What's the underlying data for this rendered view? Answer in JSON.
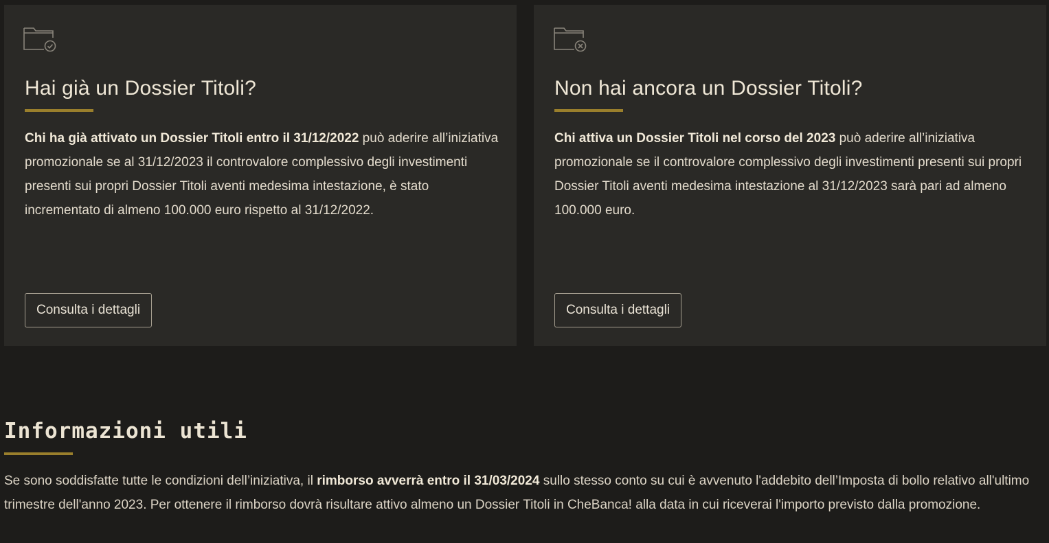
{
  "cards": [
    {
      "icon": "folder-check-icon",
      "title": "Hai già un Dossier Titoli?",
      "body_bold": "Chi ha già attivato un Dossier Titoli entro il 31/12/2022",
      "body_rest": " può aderire all’iniziativa promozionale se al 31/12/2023 il controvalore complessivo degli investimenti presenti sui propri Dossier Titoli aventi medesima intestazione, è stato incrementato di almeno 100.000 euro rispetto al 31/12/2022.",
      "button_label": "Consulta i dettagli"
    },
    {
      "icon": "folder-x-icon",
      "title": "Non hai ancora un Dossier Titoli?",
      "body_bold": "Chi attiva un Dossier Titoli nel corso del 2023",
      "body_rest": " può aderire all’iniziativa promozionale se il controvalore complessivo degli investimenti presenti sui propri Dossier Titoli aventi medesima intestazione al 31/12/2023 sarà pari ad almeno 100.000 euro.",
      "button_label": "Consulta i dettagli"
    }
  ],
  "info": {
    "title": "Informazioni utili",
    "body_pre": "Se sono soddisfatte tutte le condizioni dell’iniziativa, il ",
    "body_bold": "rimborso avverrà entro il 31/03/2024",
    "body_post": " sullo stesso conto su cui è avvenuto l'addebito dell’Imposta di bollo relativo all'ultimo trimestre dell'anno 2023. Per ottenere il rimborso dovrà risultare attivo almeno un Dossier Titoli in CheBanca! alla data in cui riceverai l'importo previsto dalla promozione."
  },
  "colors": {
    "page_bg": "#1d1c1a",
    "card_bg": "#2a2926",
    "accent_gold": "#9a7f2c",
    "text": "#e9e2d4"
  }
}
